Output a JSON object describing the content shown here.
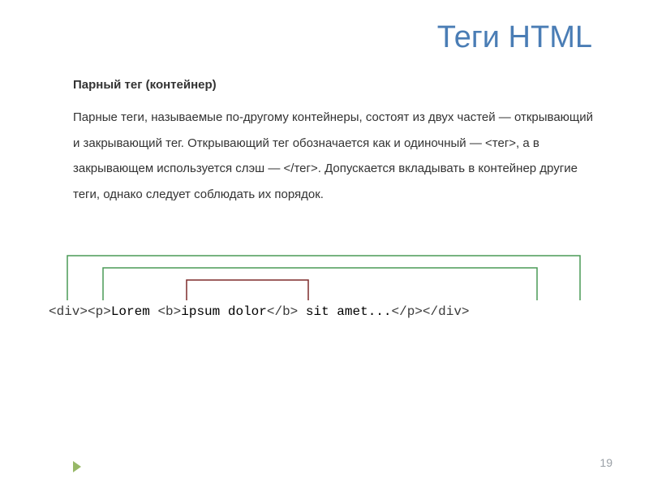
{
  "title": "Теги HTML",
  "subtitle": "Парный тег (контейнер)",
  "body": "Парные теги, называемые по-другому контейнеры, состоят из двух частей — открывающий и закрывающий тег. Открывающий тег обозначается как и одиночный — <тег>, а в закрывающем используется слэш — </тег>. Допускается вкладывать в контейнер другие теги, однако следует соблюдать их порядок.",
  "code": {
    "t_div_open": "<div>",
    "t_p_open": "<p>",
    "txt1": "Lorem ",
    "t_b_open": "<b>",
    "txt2": "ipsum dolor",
    "t_b_close": "</b>",
    "txt3": " sit amet...",
    "t_p_close": "</p>",
    "t_div_close": "</div>"
  },
  "footer": {
    "page": "19"
  },
  "colors": {
    "title": "#4a7db5",
    "bracket_outer": "#4a9a57",
    "bracket_inner": "#7f2b2b"
  }
}
